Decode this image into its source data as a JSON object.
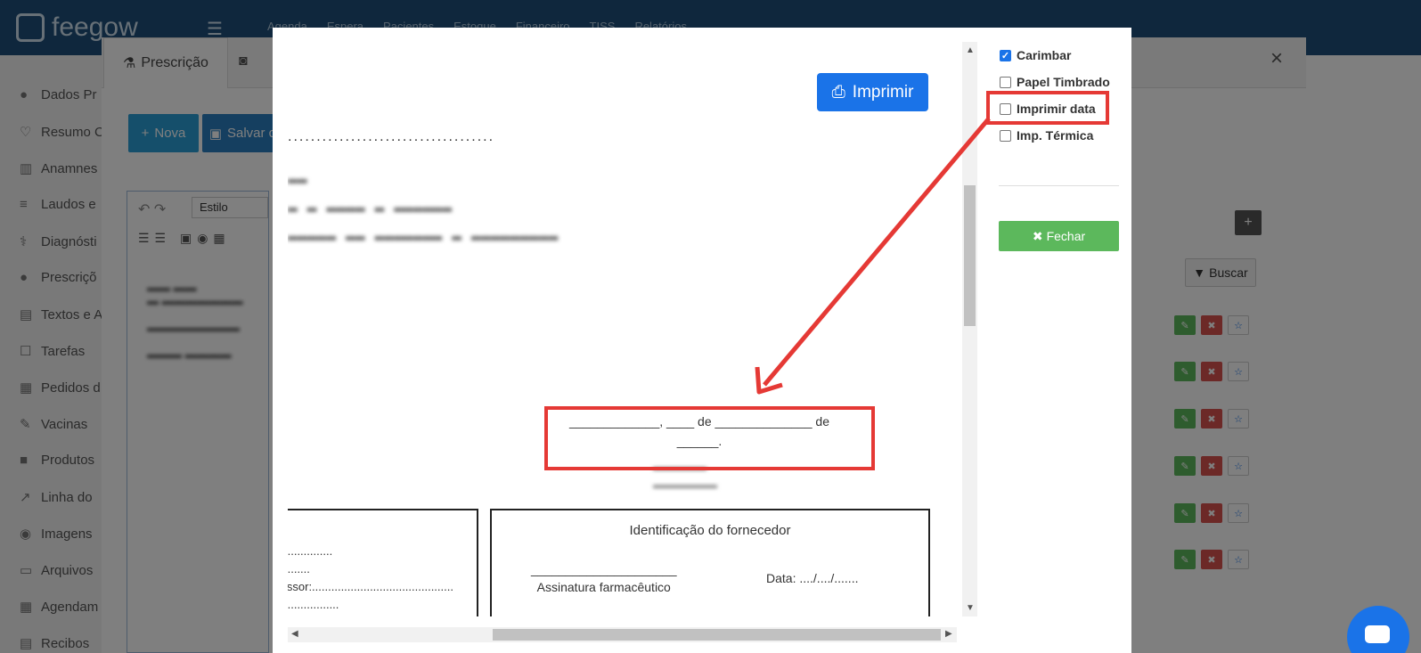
{
  "app": {
    "logo_text": "feegow"
  },
  "topnav": [
    "Agenda",
    "Espera",
    "Pacientes",
    "Estoque",
    "Financeiro",
    "TISS",
    "Relatórios"
  ],
  "sidebar": {
    "items": [
      {
        "label": "Dados Pr",
        "icon": "user-icon"
      },
      {
        "label": "Resumo C",
        "icon": "heart-icon"
      },
      {
        "label": "Anamnes",
        "icon": "chart-icon"
      },
      {
        "label": "Laudos e",
        "icon": "list-icon"
      },
      {
        "label": "Diagnósti",
        "icon": "stethoscope-icon"
      },
      {
        "label": "Prescriçõ",
        "icon": "user-icon"
      },
      {
        "label": "Textos e A",
        "icon": "document-icon"
      },
      {
        "label": "Tarefas",
        "icon": "check-icon"
      },
      {
        "label": "Pedidos d",
        "icon": "clipboard-icon"
      },
      {
        "label": "Vacinas",
        "icon": "syringe-icon"
      },
      {
        "label": "Produtos",
        "icon": "box-icon"
      },
      {
        "label": "Linha do",
        "icon": "line-chart-icon"
      },
      {
        "label": "Imagens",
        "icon": "camera-icon"
      },
      {
        "label": "Arquivos",
        "icon": "folder-icon"
      },
      {
        "label": "Agendam",
        "icon": "calendar-icon"
      },
      {
        "label": "Recibos",
        "icon": "receipt-icon"
      }
    ]
  },
  "panel": {
    "tab_active": "Prescrição",
    "tab_active_icon": "flask-icon",
    "btn_nova": "Nova",
    "btn_salvar": "Salvar c",
    "editor_style_select": "Estilo",
    "buscar": "Buscar"
  },
  "modal": {
    "options": [
      {
        "label": "Carimbar",
        "checked": true
      },
      {
        "label": "Papel Timbrado",
        "checked": false
      },
      {
        "label": "Imprimir data",
        "checked": false
      },
      {
        "label": "Imp. Térmica",
        "checked": false
      }
    ],
    "fechar": "Fechar",
    "imprimir": "Imprimir",
    "doc": {
      "dotted_line": "....................................",
      "date_line": "_____________, ____ de ______________ de ______.",
      "signature_line": "______________________________",
      "supplier_title": "Identificação do fornecedor",
      "pharm_sig_line": "_____________________",
      "pharm_sig_label": "Assinatura farmacêutico",
      "data_label": "Data: ..../..../.......",
      "left_box_lines": [
        "...............",
        "........",
        "issor:............................................",
        ".................",
        "................"
      ]
    }
  },
  "colors": {
    "accent": "#1a73e8",
    "highlight": "#e53935",
    "success": "#5cb85c",
    "danger": "#d9534f",
    "topbar": "#1f4f7a"
  }
}
